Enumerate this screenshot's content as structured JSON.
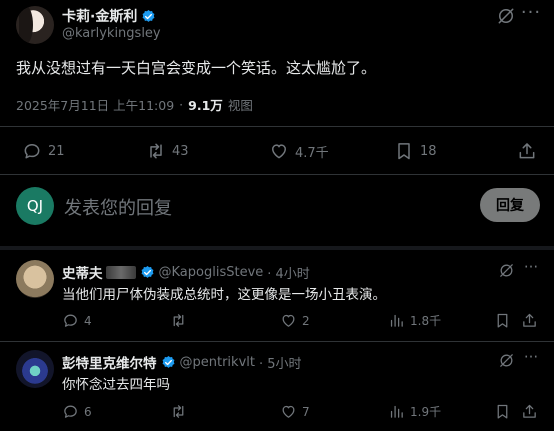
{
  "main_post": {
    "author_name": "卡莉·金斯利",
    "author_handle": "@karlykingsley",
    "text": "我从没想过有一天白宫会变成一个笑话。这太尴尬了。",
    "timestamp": "2025年7月11日 上午11:09",
    "separator": "·",
    "views_count": "9.1万",
    "views_label": "视图",
    "stats": {
      "replies": "21",
      "reposts": "43",
      "likes": "4.7千",
      "bookmarks": "18"
    }
  },
  "compose": {
    "avatar_initials": "QJ",
    "placeholder": "发表您的回复",
    "reply_button": "回复"
  },
  "replies": [
    {
      "author_name": "史蒂夫",
      "author_handle": "@KapoglisSteve",
      "time": "· 4小时",
      "text": "当他们用尸体伪装成总统时，这更像是一场小丑表演。",
      "stats": {
        "replies": "4",
        "reposts": "",
        "likes": "2",
        "views": "1.8千"
      }
    },
    {
      "author_name": "彭特里克维尔特",
      "author_handle": "@pentrikvlt",
      "time": "· 5小时",
      "text": "你怀念过去四年吗",
      "stats": {
        "replies": "6",
        "reposts": "",
        "likes": "7",
        "views": "1.9千"
      }
    }
  ],
  "colors": {
    "background": "#000000",
    "text": "#e7e9ea",
    "muted": "#71767b",
    "divider": "#2f3336",
    "verified": "#1d9bf0",
    "compose_avatar": "#1a7a63"
  }
}
